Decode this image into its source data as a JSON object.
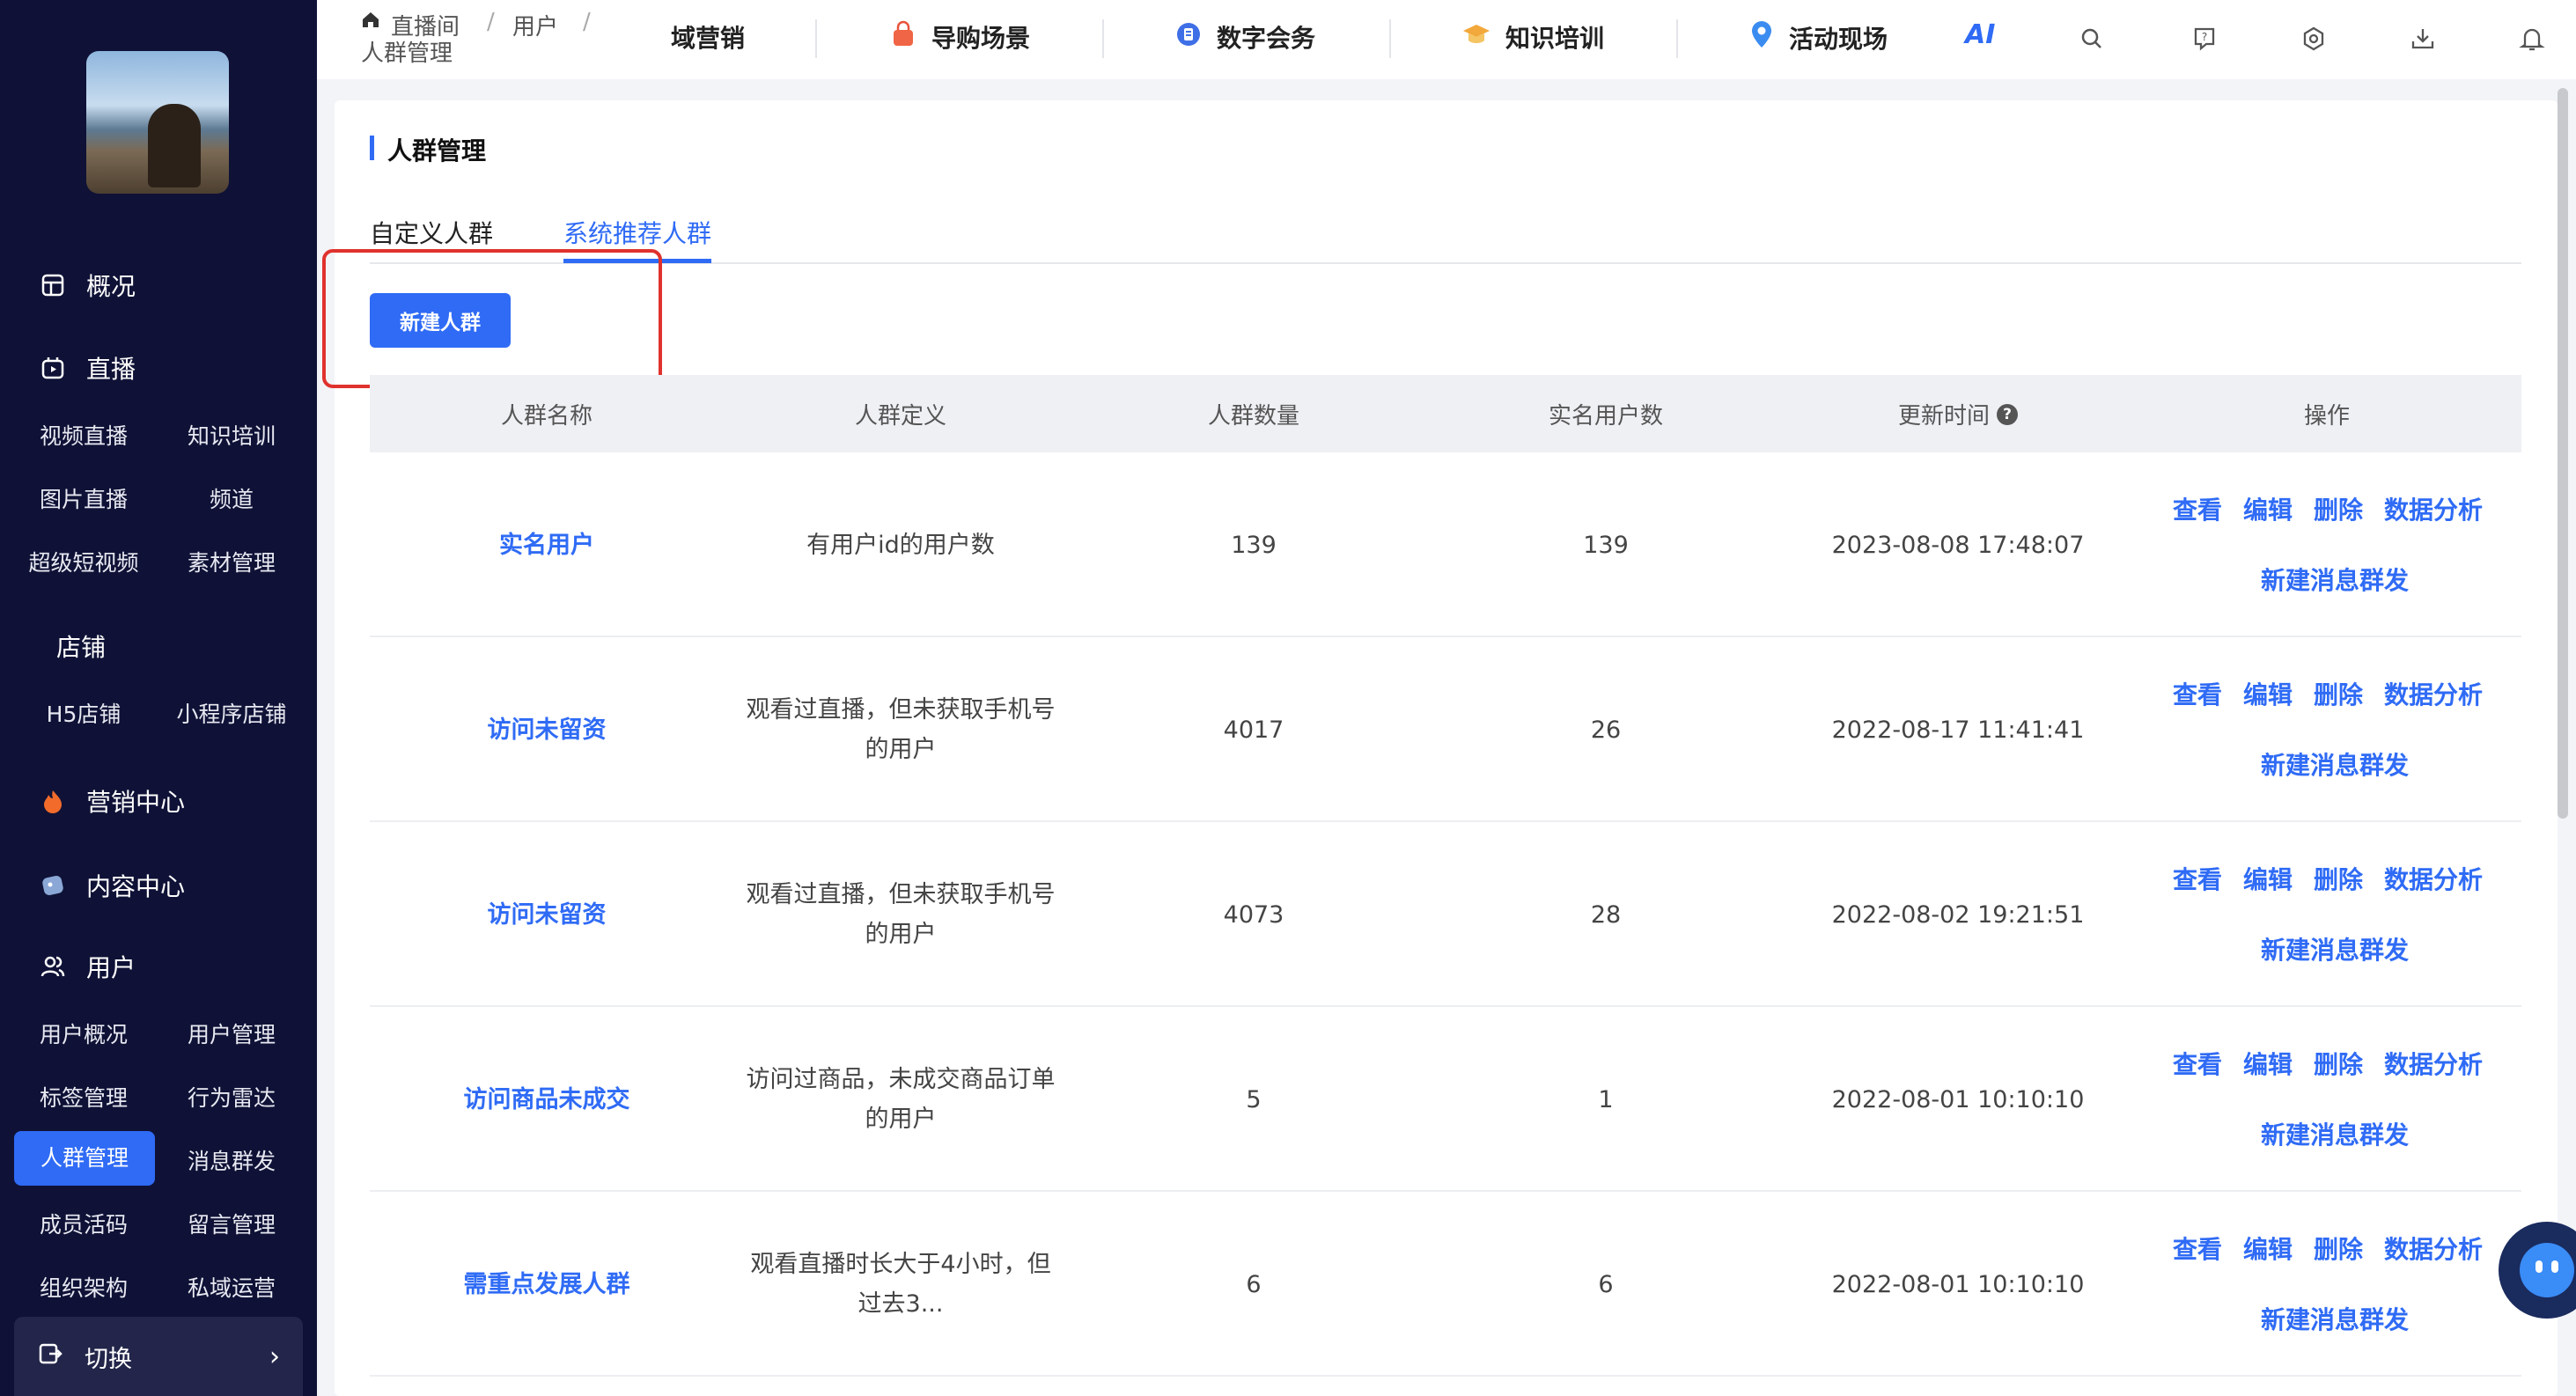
{
  "sidebar": {
    "overview": "概况",
    "live": "直播",
    "live_items": [
      "视频直播",
      "知识培训",
      "图片直播",
      "频道",
      "超级短视频",
      "素材管理"
    ],
    "shop": "店铺",
    "shop_items": [
      "H5店铺",
      "小程序店铺"
    ],
    "marketing": "营销中心",
    "content": "内容中心",
    "user": "用户",
    "user_items": [
      "用户概况",
      "用户管理",
      "标签管理",
      "行为雷达",
      "人群管理",
      "消息群发",
      "成员活码",
      "留言管理",
      "组织架构",
      "私域运营"
    ],
    "active_item": "人群管理",
    "switch": "切换"
  },
  "breadcrumb": {
    "root": "直播间",
    "sep1": "/",
    "level2": "用户",
    "sep2": "/",
    "current": "人群管理"
  },
  "topnav": {
    "items": [
      "域营销",
      "导购场景",
      "数字会务",
      "知识培训",
      "活动现场"
    ],
    "ai": "AI"
  },
  "page": {
    "title": "人群管理",
    "tabs": [
      "自定义人群",
      "系统推荐人群"
    ],
    "active_tab": "系统推荐人群",
    "new_button": "新建人群"
  },
  "table": {
    "columns": [
      "人群名称",
      "人群定义",
      "人群数量",
      "实名用户数",
      "更新时间",
      "操作"
    ],
    "rows": [
      {
        "name": "实名用户",
        "definition": "有用户id的用户数",
        "count": "139",
        "real_name": "139",
        "updated": "2023-08-08 17:48:07"
      },
      {
        "name": "访问未留资",
        "definition": "观看过直播，但未获取手机号的用户",
        "count": "4017",
        "real_name": "26",
        "updated": "2022-08-17 11:41:41"
      },
      {
        "name": "访问未留资",
        "definition": "观看过直播，但未获取手机号的用户",
        "count": "4073",
        "real_name": "28",
        "updated": "2022-08-02 19:21:51"
      },
      {
        "name": "访问商品未成交",
        "definition": "访问过商品，未成交商品订单的用户",
        "count": "5",
        "real_name": "1",
        "updated": "2022-08-01 10:10:10"
      },
      {
        "name": "需重点发展人群",
        "definition": "观看直播时长大于4小时，但过去3...",
        "count": "6",
        "real_name": "6",
        "updated": "2022-08-01 10:10:10"
      }
    ],
    "actions": {
      "view": "查看",
      "edit": "编辑",
      "delete": "删除",
      "analysis": "数据分析",
      "broadcast": "新建消息群发"
    }
  },
  "colors": {
    "accent": "#2f6bf5",
    "sidebar_bg": "#0f1236",
    "highlight_box": "#e0322e"
  }
}
